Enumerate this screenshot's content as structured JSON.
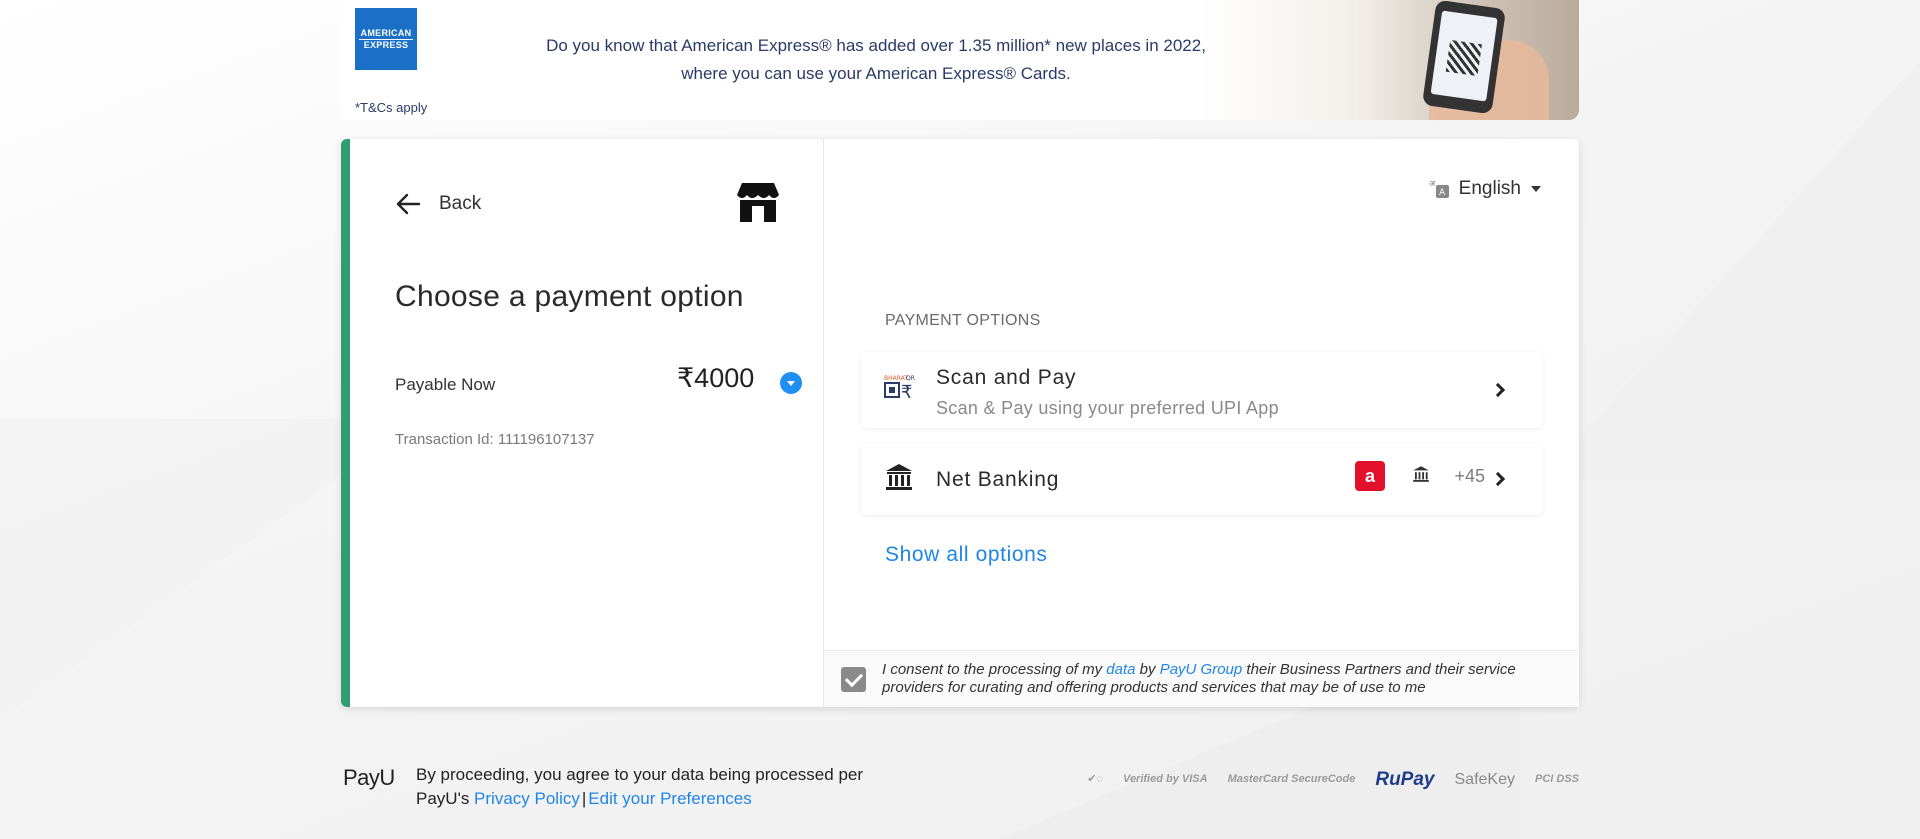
{
  "banner": {
    "brand_logo_label": "AMERICAN EXPRESS",
    "line1": "Do you know that American Express® has added over 1.35 million* new places in 2022,",
    "line2": "where you can use your American Express® Cards.",
    "terms": "*T&Cs apply"
  },
  "left_panel": {
    "back_label": "Back",
    "title": "Choose a payment option",
    "payable_label": "Payable Now",
    "amount": "₹4000",
    "transaction": "Transaction Id: 111196107137"
  },
  "right_panel": {
    "language": "English",
    "section_title": "PAYMENT OPTIONS",
    "options": [
      {
        "title": "Scan and Pay",
        "subtitle": "Scan & Pay using your preferred UPI App",
        "icon": "bharat-qr-icon"
      },
      {
        "title": "Net Banking",
        "icon": "bank-icon",
        "extra_count": "+45"
      }
    ],
    "show_all": "Show all options",
    "consent": {
      "before": "I consent to the processing of my ",
      "link1": "data",
      "middle": " by ",
      "link2": "PayU Group",
      "after": " their Business Partners and their service providers for curating and offering products and services that may be of use to me",
      "checked": true
    }
  },
  "footer": {
    "logo": "PayU",
    "text_line1": "By proceeding, you agree to your data being processed per",
    "text_line2_prefix": "PayU's ",
    "privacy_link": "Privacy Policy",
    "separator": "|",
    "preferences_link": "Edit your Preferences",
    "badges": [
      "Verified by VISA",
      "MasterCard SecureCode",
      "RuPay",
      "SafeKey",
      "PCI DSS"
    ]
  },
  "colors": {
    "accent_green": "#2e9e72",
    "link_blue": "#1f86e8",
    "amex_blue": "#1c6fc7",
    "airtel_red": "#e3102c"
  }
}
